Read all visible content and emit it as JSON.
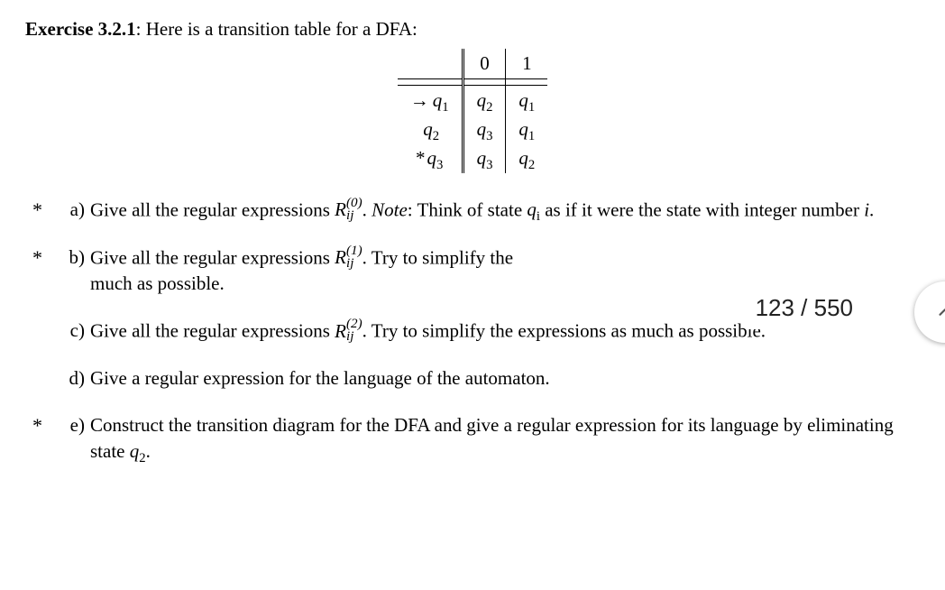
{
  "exercise": {
    "label": "Exercise 3.2.1",
    "intro_after_colon": " Here is a transition table for a DFA:"
  },
  "table": {
    "headers": {
      "blank": "",
      "c0": "0",
      "c1": "1"
    },
    "rows": [
      {
        "marker": "→",
        "state_letter": "q",
        "state_sub": "1",
        "on0_letter": "q",
        "on0_sub": "2",
        "on1_letter": "q",
        "on1_sub": "1"
      },
      {
        "marker": "",
        "state_letter": "q",
        "state_sub": "2",
        "on0_letter": "q",
        "on0_sub": "3",
        "on1_letter": "q",
        "on1_sub": "1"
      },
      {
        "marker": "*",
        "state_letter": "q",
        "state_sub": "3",
        "on0_letter": "q",
        "on0_sub": "3",
        "on1_letter": "q",
        "on1_sub": "2"
      }
    ]
  },
  "R_label": "R",
  "R_subscript": "ij",
  "items": {
    "a": {
      "marker": "a)",
      "starred": true,
      "pre": "Give all the regular expressions ",
      "sup": "(0)",
      "post1": ". ",
      "note_word": "Note",
      "post2": ": Think of state ",
      "qi_letter": "q",
      "qi_sub": "i",
      "post3": " as if it were the state with integer number ",
      "ivar": "i",
      "post4": "."
    },
    "b": {
      "marker": "b)",
      "starred": true,
      "pre": "Give all the regular expressions ",
      "sup": "(1)",
      "post": ". Try to simplify the",
      "line2": "much as possible."
    },
    "c": {
      "marker": "c)",
      "starred": false,
      "pre": "Give all the regular expressions ",
      "sup": "(2)",
      "post": ". Try to simplify the expressions as much as possible."
    },
    "d": {
      "marker": "d)",
      "starred": false,
      "text": "Give a regular expression for the language of the automaton."
    },
    "e": {
      "marker": "e)",
      "starred": true,
      "text_pre": "Construct the transition diagram for the DFA and give a regular expression for its language by eliminating state ",
      "q_letter": "q",
      "q_sub": "2",
      "text_post": "."
    }
  },
  "overlay": {
    "page_indicator": "123 / 550"
  }
}
